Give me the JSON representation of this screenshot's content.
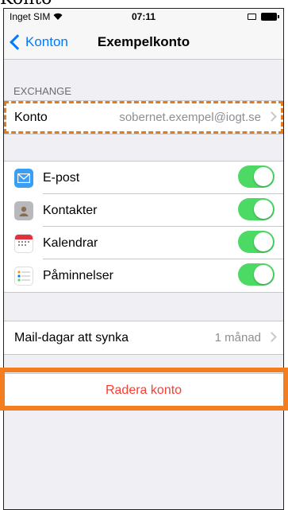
{
  "cutoff_text": "Konto",
  "status": {
    "carrier": "Inget SIM",
    "time": "07:11"
  },
  "nav": {
    "back_label": "Konton",
    "title": "Exempelkonto"
  },
  "section_header": "EXCHANGE",
  "account_row": {
    "label": "Konto",
    "value": "sobernet.exempel@iogt.se"
  },
  "services": [
    {
      "label": "E-post",
      "icon": "mail-icon",
      "on": true
    },
    {
      "label": "Kontakter",
      "icon": "contacts-icon",
      "on": true
    },
    {
      "label": "Kalendrar",
      "icon": "calendar-icon",
      "on": true
    },
    {
      "label": "Påminnelser",
      "icon": "reminders-icon",
      "on": true
    }
  ],
  "sync_row": {
    "label": "Mail-dagar att synka",
    "value": "1 månad"
  },
  "delete_label": "Radera konto",
  "colors": {
    "accent": "#007aff",
    "toggle_on": "#4cd964",
    "destructive": "#ff3b30",
    "highlight": "#f47d20"
  }
}
